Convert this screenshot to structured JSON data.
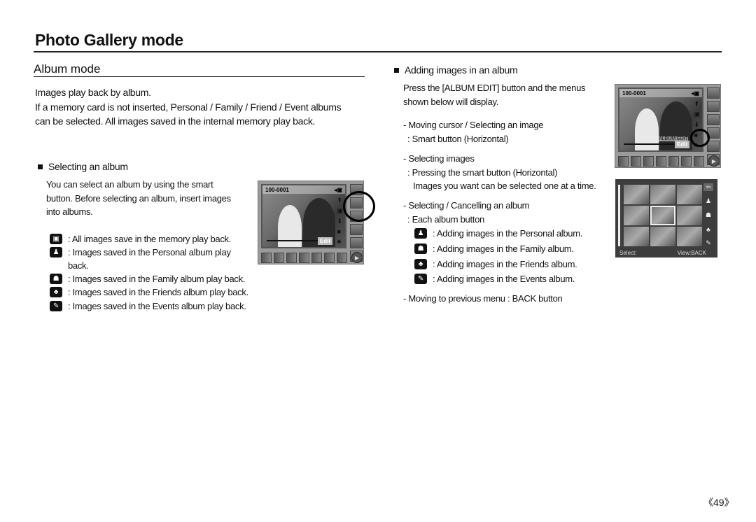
{
  "page": {
    "title": "Photo Gallery mode",
    "section_title": "Album mode",
    "page_number": "《49》"
  },
  "intro": {
    "line1": "Images play back by album.",
    "line2": "If a memory card is not inserted, Personal / Family / Friend / Event albums",
    "line3": "can be selected. All images saved in the internal memory play back."
  },
  "selecting": {
    "heading": "Selecting an album",
    "body1": "You can select an album by using the smart",
    "body2": "button. Before selecting an album, insert images",
    "body3": "into albums.",
    "items": [
      {
        "icon": "all-images-icon",
        "glyph": "▣",
        "text": ": All images save in the memory play back."
      },
      {
        "icon": "personal-album-icon",
        "glyph": "♟",
        "text": ": Images saved in the Personal album play back."
      },
      {
        "icon": "family-album-icon",
        "glyph": "☗",
        "text": ": Images saved in the Family album play back."
      },
      {
        "icon": "friends-album-icon",
        "glyph": "♣",
        "text": ": Images saved in the Friends album play back."
      },
      {
        "icon": "events-album-icon",
        "glyph": "✎",
        "text": ": Images saved in the Events album play back."
      }
    ]
  },
  "adding": {
    "heading": "Adding images in an album",
    "body1": "Press the [ALBUM EDIT] button and the menus",
    "body2": "shown below will display.",
    "step1a": "- Moving cursor / Selecting an image",
    "step1b": ": Smart button (Horizontal)",
    "step2a": "- Selecting images",
    "step2b": ": Pressing the smart button (Horizontal)",
    "step2c": "Images you want can be selected one at a time.",
    "step3a": "- Selecting / Cancelling an album",
    "step3b": ": Each album button",
    "items": [
      {
        "icon": "personal-album-icon",
        "glyph": "♟",
        "text": ": Adding images in the Personal album."
      },
      {
        "icon": "family-album-icon",
        "glyph": "☗",
        "text": ": Adding images in the Family album."
      },
      {
        "icon": "friends-album-icon",
        "glyph": "♣",
        "text": ": Adding images in the Friends album."
      },
      {
        "icon": "events-album-icon",
        "glyph": "✎",
        "text": ": Adding images in the Events album."
      }
    ],
    "step4": "- Moving to previous menu : BACK button"
  },
  "camera1": {
    "file_number": "100-0001",
    "edit_label": "Edit"
  },
  "camera2": {
    "file_number": "100-0001",
    "edit_label": "Edit",
    "album_edit_label": "ALBUM EDIT"
  },
  "grid_screen": {
    "select_label": "Select:",
    "view_label": "View:BACK"
  }
}
